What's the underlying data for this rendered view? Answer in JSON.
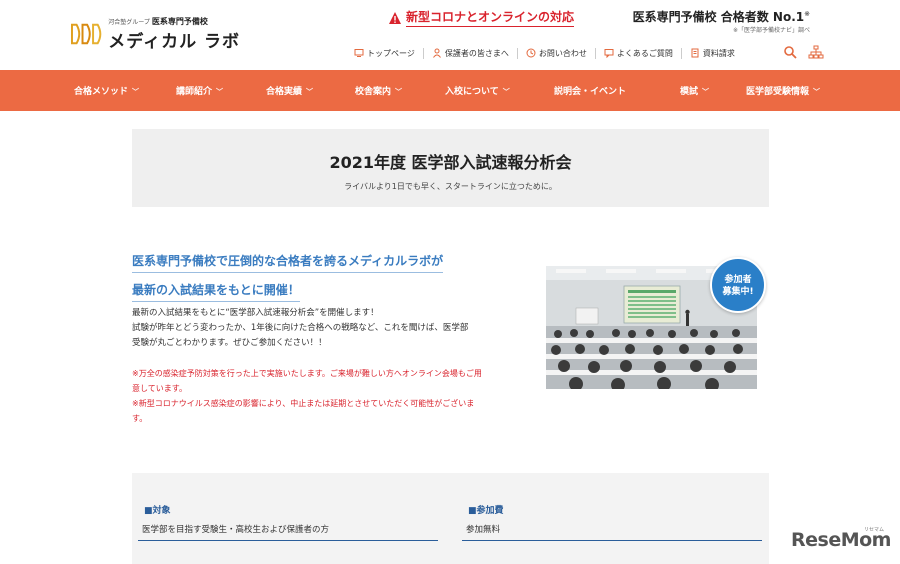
{
  "header": {
    "logo": {
      "group": "河合塾グループ",
      "school": "医系専門予備校",
      "name": "メディカル ラボ",
      "mark": "ddd-logo"
    },
    "covid_notice": "新型コロナとオンラインの対応",
    "rank_title": "医系専門予備校 合格者数 No.1",
    "rank_mark": "※",
    "rank_note": "※「医学部予備校ナビ」調べ",
    "top_nav": [
      {
        "label": "トップページ",
        "icon": "monitor-icon"
      },
      {
        "label": "保護者の皆さまへ",
        "icon": "person-icon"
      },
      {
        "label": "お問い合わせ",
        "icon": "clock-icon"
      },
      {
        "label": "よくあるご質問",
        "icon": "chat-icon"
      },
      {
        "label": "資料請求",
        "icon": "document-icon"
      }
    ]
  },
  "menu": [
    {
      "label": "合格メソッド",
      "chevron": true
    },
    {
      "label": "講師紹介",
      "chevron": true
    },
    {
      "label": "合格実績",
      "chevron": true
    },
    {
      "label": "校舎案内",
      "chevron": true
    },
    {
      "label": "入校について",
      "chevron": true
    },
    {
      "label": "説明会・イベント",
      "chevron": false
    },
    {
      "label": "模試",
      "chevron": true
    },
    {
      "label": "医学部受験情報",
      "chevron": true
    }
  ],
  "hero": {
    "title": "2021年度 医学部入試速報分析会",
    "subtitle": "ライバルより1日でも早く、スタートラインに立つために。"
  },
  "lead": {
    "line1": "医系専門予備校で圧倒的な合格者を誇るメディカルラボが",
    "line2": "最新の入試結果をもとに開催！"
  },
  "body": {
    "p1": "最新の入試結果をもとに“医学部入試速報分析会”を開催します！",
    "p2": "試験が昨年とどう変わったか、1年後に向けた合格への戦略など、これを聞けば、医学部",
    "p3": "受験が丸ごとわかります。ぜひご参加ください！！"
  },
  "notice": {
    "n1a": "※万全の感染症予防対策を行った上で実施いたします。ご来場が難しい方へオンライン会場もご用",
    "n1b": "意しています。",
    "n2a": "※新型コロナウイルス感染症の影響により、中止または延期とさせていただく可能性がございま",
    "n2b": "す。"
  },
  "badge": {
    "line1": "参加者",
    "line2": "募集中!"
  },
  "info": [
    {
      "label": "■対象",
      "value": "医学部を目指す受験生・高校生および保護者の方"
    },
    {
      "label": "■参加費",
      "value": "参加無料"
    }
  ],
  "watermark": {
    "text": "ReseMom",
    "small": "リセマム"
  },
  "colors": {
    "accent": "#ec6a43",
    "link_blue": "#3a7cc0",
    "notice_red": "#d9232d",
    "badge_blue": "#2a7fc8"
  }
}
